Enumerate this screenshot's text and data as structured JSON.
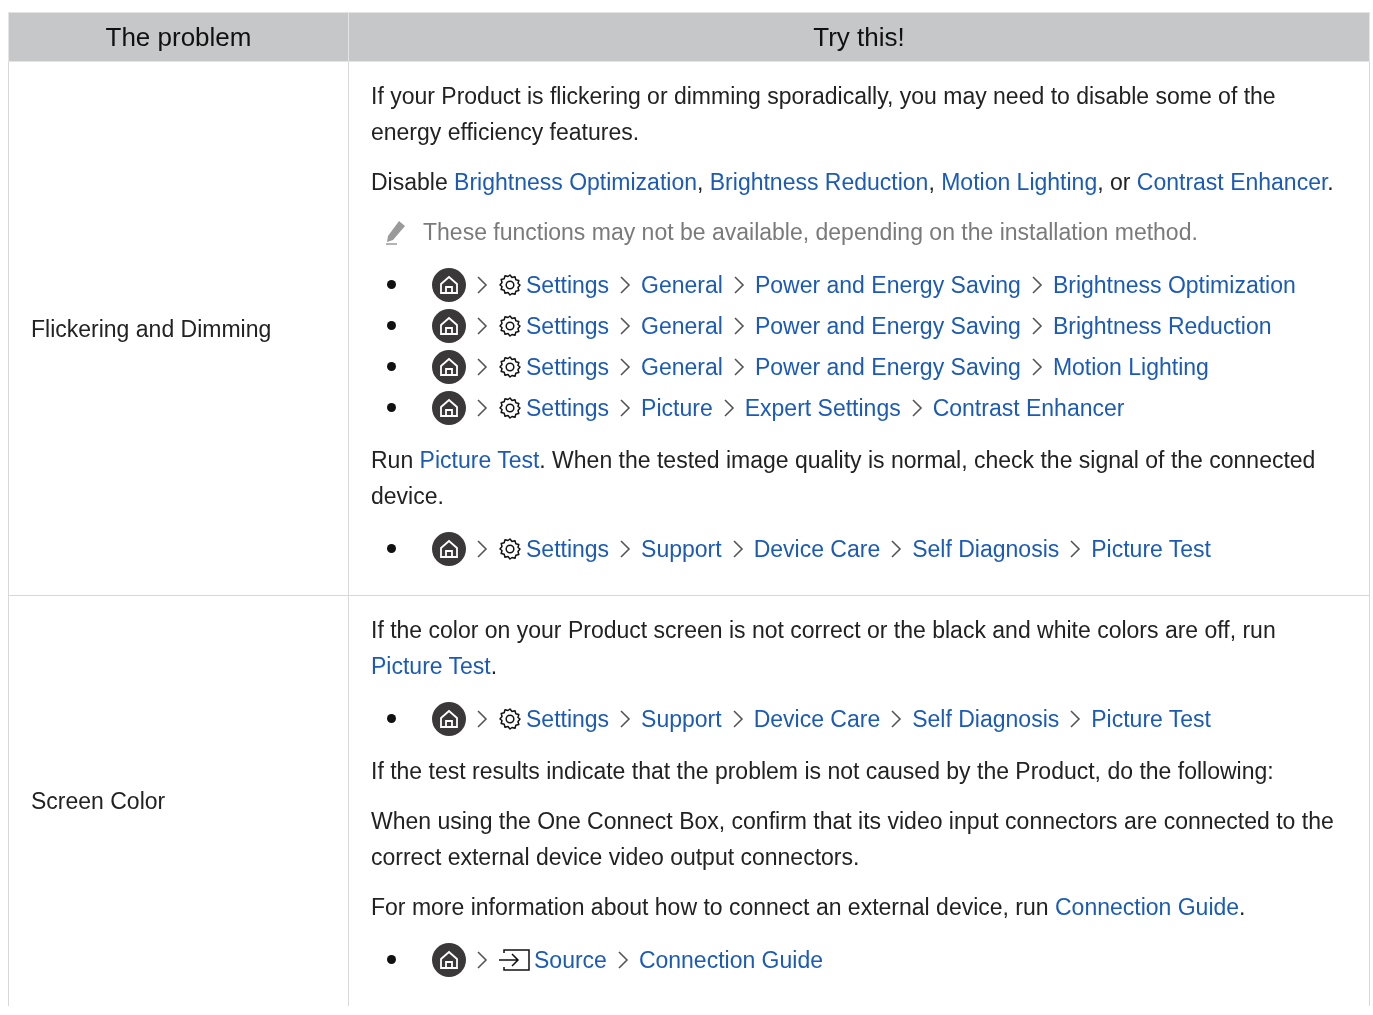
{
  "table": {
    "columns": [
      "The problem",
      "Try this!"
    ],
    "rows": [
      {
        "problem": "Flickering and Dimming",
        "blocks": [
          {
            "kind": "paragraph",
            "segments": [
              {
                "kind": "text",
                "text": "If your Product is flickering or dimming sporadically, you may need to disable some of the energy efficiency features."
              }
            ]
          },
          {
            "kind": "paragraph",
            "segments": [
              {
                "kind": "text",
                "text": "Disable "
              },
              {
                "kind": "link",
                "text": "Brightness Optimization"
              },
              {
                "kind": "text",
                "text": ", "
              },
              {
                "kind": "link",
                "text": "Brightness Reduction"
              },
              {
                "kind": "text",
                "text": ", "
              },
              {
                "kind": "link",
                "text": "Motion Lighting"
              },
              {
                "kind": "text",
                "text": ", or "
              },
              {
                "kind": "link",
                "text": "Contrast Enhancer"
              },
              {
                "kind": "text",
                "text": "."
              }
            ]
          },
          {
            "kind": "note",
            "text": "These functions may not be available, depending on the installation method."
          },
          {
            "kind": "paths",
            "paths": [
              [
                {
                  "kind": "home"
                },
                {
                  "kind": "settings",
                  "label": "Settings"
                },
                {
                  "kind": "plain",
                  "label": "General"
                },
                {
                  "kind": "plain",
                  "label": "Power and Energy Saving"
                },
                {
                  "kind": "plain",
                  "label": "Brightness Optimization"
                }
              ],
              [
                {
                  "kind": "home"
                },
                {
                  "kind": "settings",
                  "label": "Settings"
                },
                {
                  "kind": "plain",
                  "label": "General"
                },
                {
                  "kind": "plain",
                  "label": "Power and Energy Saving"
                },
                {
                  "kind": "plain",
                  "label": "Brightness Reduction"
                }
              ],
              [
                {
                  "kind": "home"
                },
                {
                  "kind": "settings",
                  "label": "Settings"
                },
                {
                  "kind": "plain",
                  "label": "General"
                },
                {
                  "kind": "plain",
                  "label": "Power and Energy Saving"
                },
                {
                  "kind": "plain",
                  "label": "Motion Lighting"
                }
              ],
              [
                {
                  "kind": "home"
                },
                {
                  "kind": "settings",
                  "label": "Settings"
                },
                {
                  "kind": "plain",
                  "label": "Picture"
                },
                {
                  "kind": "plain",
                  "label": "Expert Settings"
                },
                {
                  "kind": "plain",
                  "label": "Contrast Enhancer"
                }
              ]
            ]
          },
          {
            "kind": "paragraph",
            "segments": [
              {
                "kind": "text",
                "text": "Run "
              },
              {
                "kind": "link",
                "text": "Picture Test"
              },
              {
                "kind": "text",
                "text": ". When the tested image quality is normal, check the signal of the connected device."
              }
            ]
          },
          {
            "kind": "paths",
            "paths": [
              [
                {
                  "kind": "home"
                },
                {
                  "kind": "settings",
                  "label": "Settings"
                },
                {
                  "kind": "plain",
                  "label": "Support"
                },
                {
                  "kind": "plain",
                  "label": "Device Care"
                },
                {
                  "kind": "plain",
                  "label": "Self Diagnosis"
                },
                {
                  "kind": "plain",
                  "label": "Picture Test"
                }
              ]
            ]
          }
        ]
      },
      {
        "problem": "Screen Color",
        "blocks": [
          {
            "kind": "paragraph",
            "segments": [
              {
                "kind": "text",
                "text": "If the color on your Product screen is not correct or the black and white colors are off, run "
              },
              {
                "kind": "link",
                "text": "Picture Test"
              },
              {
                "kind": "text",
                "text": "."
              }
            ]
          },
          {
            "kind": "paths",
            "paths": [
              [
                {
                  "kind": "home"
                },
                {
                  "kind": "settings",
                  "label": "Settings"
                },
                {
                  "kind": "plain",
                  "label": "Support"
                },
                {
                  "kind": "plain",
                  "label": "Device Care"
                },
                {
                  "kind": "plain",
                  "label": "Self Diagnosis"
                },
                {
                  "kind": "plain",
                  "label": "Picture Test"
                }
              ]
            ]
          },
          {
            "kind": "paragraph",
            "segments": [
              {
                "kind": "text",
                "text": "If the test results indicate that the problem is not caused by the Product, do the following:"
              }
            ]
          },
          {
            "kind": "paragraph",
            "segments": [
              {
                "kind": "text",
                "text": "When using the One Connect Box, confirm that its video input connectors are connected to the correct external device video output connectors."
              }
            ]
          },
          {
            "kind": "paragraph",
            "segments": [
              {
                "kind": "text",
                "text": "For more information about how to connect an external device, run "
              },
              {
                "kind": "link",
                "text": "Connection Guide"
              },
              {
                "kind": "text",
                "text": "."
              }
            ]
          },
          {
            "kind": "paths",
            "paths": [
              [
                {
                  "kind": "home"
                },
                {
                  "kind": "source",
                  "label": "Source"
                },
                {
                  "kind": "plain",
                  "label": "Connection Guide"
                }
              ]
            ]
          }
        ]
      }
    ]
  }
}
